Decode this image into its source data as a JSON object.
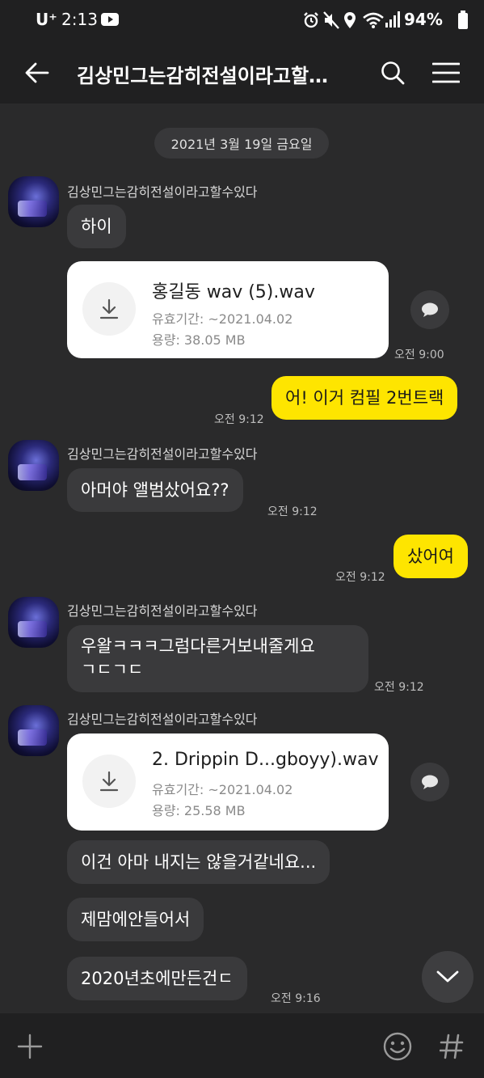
{
  "status_bar": {
    "carrier": "U⁺",
    "time": "2:13",
    "battery": "94%"
  },
  "header": {
    "title": "김상민그는감히전설이라고할수있다"
  },
  "date_divider": "2021년 3월 19일 금요일",
  "messages": {
    "sender_name": "김상민그는감히전설이라고할수있다",
    "m1": "하이",
    "file1": {
      "name": "홍길동 wav (5).wav",
      "expiry": "유효기간: ~2021.04.02",
      "size": "용량: 38.05 MB",
      "time": "오전 9:00"
    },
    "out1": {
      "text": "어! 이거 컴필 2번트랙",
      "time": "오전 9:12"
    },
    "m2": {
      "text": "아머야 앨범샀어요??",
      "time": "오전 9:12"
    },
    "out2": {
      "text": "샀어여",
      "time": "오전 9:12"
    },
    "m3": {
      "line1": "우왈ㅋㅋㅋ그럼다른거보내줄게요",
      "line2": "ㄱㄷㄱㄷ",
      "time": "오전 9:12"
    },
    "file2": {
      "name": "2. Drippin D...gboyy).wav",
      "expiry": "유효기간: ~2021.04.02",
      "size": "용량: 25.58 MB"
    },
    "m4": "이건 아마 내지는 않을거같네요...",
    "m5": "제맘에안들어서",
    "m6": {
      "text": "2020년초에만든건ㄷ",
      "time": "오전 9:16"
    }
  },
  "colors": {
    "background": "#2a2a2b",
    "bar": "#202021",
    "incoming_bubble": "#3a3a3c",
    "outgoing_bubble": "#fee500"
  }
}
